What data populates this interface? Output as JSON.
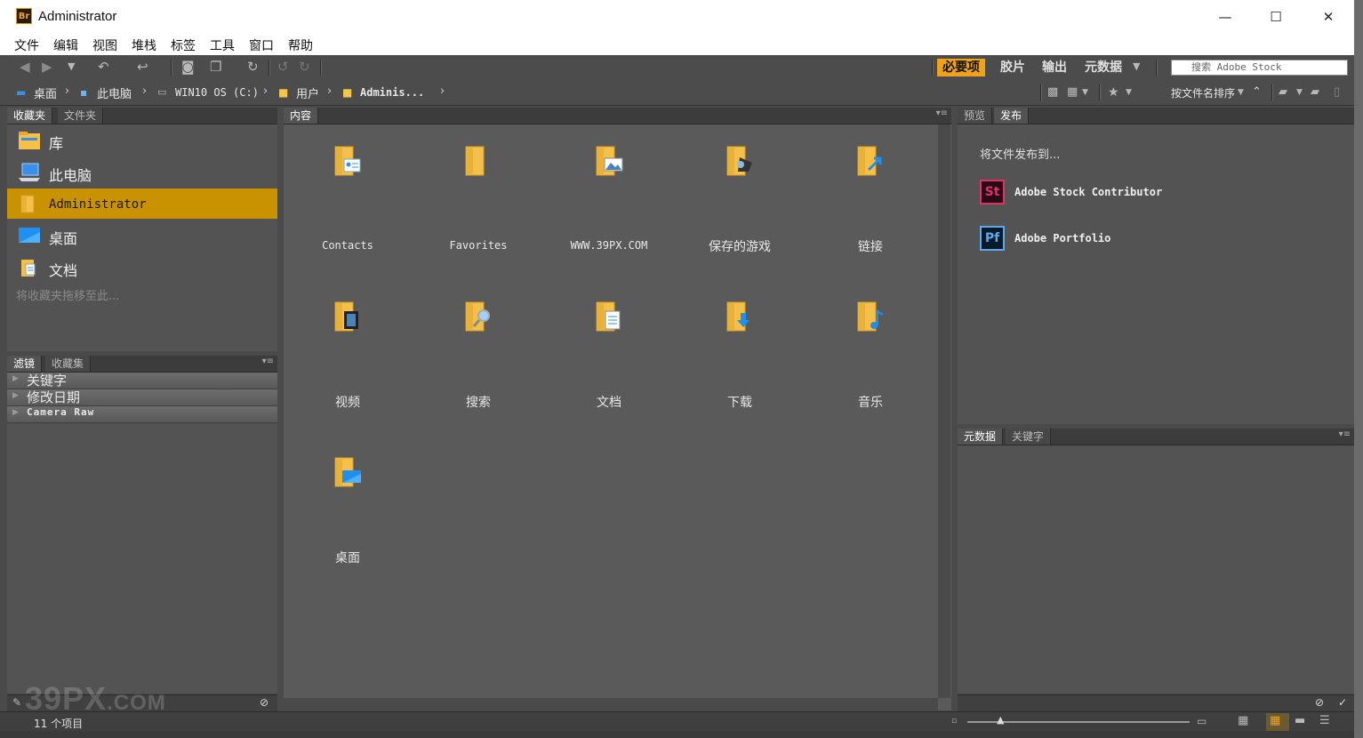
{
  "window": {
    "title": "Administrator",
    "app_logo": "Br",
    "controls": [
      "—",
      "☐",
      "✕"
    ]
  },
  "menu": [
    "文件",
    "编辑",
    "视图",
    "堆栈",
    "标签",
    "工具",
    "窗口",
    "帮助"
  ],
  "toolbar": {
    "workspaces": [
      "必要项",
      "胶片",
      "输出",
      "元数据"
    ],
    "active_workspace": "必要项",
    "search_placeholder": "搜索 Adobe Stock"
  },
  "path": {
    "crumbs": [
      "桌面",
      "此电脑",
      "WIN10 OS (C:)",
      "用户",
      "Adminis..."
    ],
    "sort_label": "按文件名排序"
  },
  "left_panel": {
    "tabs": [
      "收藏夹",
      "文件夹"
    ],
    "favorites": [
      {
        "label": "库",
        "icon": "library-folder-icon"
      },
      {
        "label": "此电脑",
        "icon": "computer-icon"
      },
      {
        "label": "Administrator",
        "icon": "user-folder-icon",
        "selected": true
      },
      {
        "label": "桌面",
        "icon": "desktop-icon"
      },
      {
        "label": "文档",
        "icon": "documents-icon"
      }
    ],
    "drag_hint": "将收藏夹拖移至此..."
  },
  "filter_panel": {
    "tabs": [
      "滤镜",
      "收藏集"
    ],
    "rows": [
      "关键字",
      "修改日期",
      "Camera Raw"
    ]
  },
  "content_panel": {
    "tab": "内容",
    "items": [
      {
        "label": "Contacts",
        "icon": "contacts-folder-icon"
      },
      {
        "label": "Favorites",
        "icon": "favorites-folder-icon"
      },
      {
        "label": "WWW.39PX.COM",
        "icon": "pictures-folder-icon"
      },
      {
        "label": "保存的游戏",
        "icon": "saved-games-folder-icon"
      },
      {
        "label": "链接",
        "icon": "links-folder-icon"
      },
      {
        "label": "视频",
        "icon": "videos-folder-icon"
      },
      {
        "label": "搜索",
        "icon": "searches-folder-icon"
      },
      {
        "label": "文档",
        "icon": "documents-folder-icon"
      },
      {
        "label": "下载",
        "icon": "downloads-folder-icon"
      },
      {
        "label": "音乐",
        "icon": "music-folder-icon"
      },
      {
        "label": "桌面",
        "icon": "desktop-folder-icon"
      }
    ]
  },
  "right_panel": {
    "tabs": [
      "预览",
      "发布"
    ],
    "publish_hint": "将文件发布到...",
    "publish_targets": [
      {
        "logo": "St",
        "label": "Adobe Stock Contributor",
        "color": "#e0306a"
      },
      {
        "logo": "Pf",
        "label": "Adobe Portfolio",
        "color": "#5aa9ee"
      }
    ]
  },
  "metadata_panel": {
    "tabs": [
      "元数据",
      "关键字"
    ]
  },
  "status": {
    "item_count": "11 个项目"
  },
  "watermark": {
    "main": "39PX",
    "suffix": ".COM"
  },
  "colors": {
    "accent": "#f0a218",
    "selection": "#c99200",
    "panel": "#535353"
  }
}
